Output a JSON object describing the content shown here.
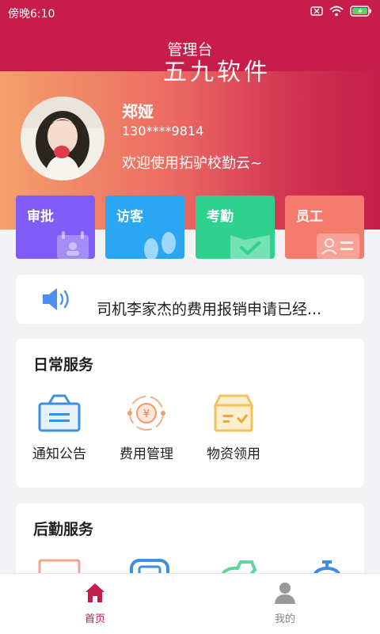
{
  "status_bar": {
    "time": "傍晚6:10"
  },
  "header": {
    "title": "管理台"
  },
  "watermark": "五九软件",
  "user": {
    "name": "郑娅",
    "phone": "130****9814",
    "welcome": "欢迎使用拓驴校勤云~"
  },
  "quick_actions": [
    {
      "label": "审批",
      "color": "#7f5cf5",
      "icon": "calendar-badge-icon"
    },
    {
      "label": "访客",
      "color": "#2aa6f4",
      "icon": "footprints-icon"
    },
    {
      "label": "考勤",
      "color": "#2fd18f",
      "icon": "check-box-icon"
    },
    {
      "label": "员工",
      "color": "#f57c6c",
      "icon": "id-card-icon"
    }
  ],
  "notice": {
    "text": "司机李家杰的费用报销申请已经..."
  },
  "daily_services": {
    "title": "日常服务",
    "items": [
      {
        "label": "通知公告",
        "icon": "notice-basket-icon"
      },
      {
        "label": "费用管理",
        "icon": "yen-coin-icon"
      },
      {
        "label": "物资领用",
        "icon": "supply-box-icon"
      }
    ]
  },
  "logistics_services": {
    "title": "后勤服务"
  },
  "bottom_nav": {
    "home": "首页",
    "mine": "我的"
  },
  "colors": {
    "primary": "#c71d4a",
    "nav_active": "#c71d4a",
    "nav_inactive": "#888888"
  }
}
